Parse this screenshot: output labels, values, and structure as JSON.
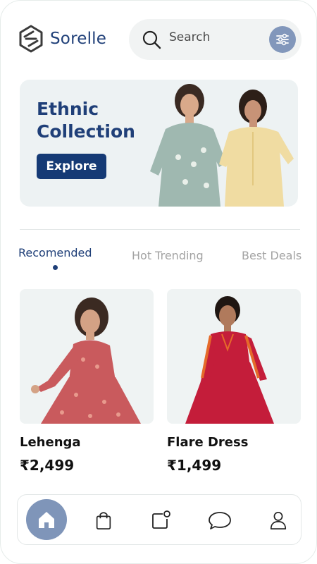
{
  "brand": {
    "name": "Sorelle"
  },
  "search": {
    "placeholder": "Search"
  },
  "banner": {
    "title": "Ethnic Collection",
    "button_label": "Explore"
  },
  "tabs": [
    {
      "label": "Recomended",
      "active": true
    },
    {
      "label": "Hot Trending",
      "active": false
    },
    {
      "label": "Best Deals",
      "active": false
    }
  ],
  "products": [
    {
      "name": "Lehenga",
      "price": "₹2,499",
      "color": "#c95a5d"
    },
    {
      "name": "Flare Dress",
      "price": "₹1,499",
      "color": "#c41d3a"
    }
  ],
  "nav": {
    "items": [
      {
        "icon": "home-icon",
        "active": true
      },
      {
        "icon": "shopping-bag-icon",
        "active": false
      },
      {
        "icon": "notification-icon",
        "active": false
      },
      {
        "icon": "chat-icon",
        "active": false
      },
      {
        "icon": "profile-icon",
        "active": false
      }
    ]
  },
  "colors": {
    "primary": "#1f3f78",
    "accent": "#8297bb",
    "muted": "#a3a3a3"
  }
}
